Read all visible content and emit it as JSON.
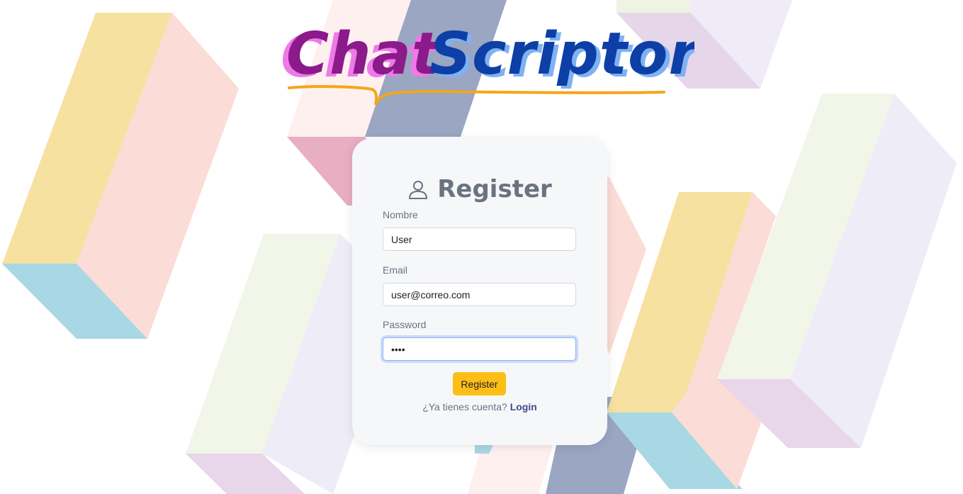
{
  "logo": {
    "part1": "Chat",
    "part2": "Scriptor"
  },
  "colors": {
    "logo_chat": "#8b1a8b",
    "logo_chat_shadow": "#ee7ae8",
    "logo_scriptor": "#0d3fa6",
    "logo_scriptor_shadow": "#7fb2f2",
    "underline": "#f4a619",
    "button": "#fbbf16",
    "link": "#3f4a8a"
  },
  "register_form": {
    "title": "Register",
    "title_icon": "user-icon",
    "nombre": {
      "label": "Nombre",
      "value": "User"
    },
    "email": {
      "label": "Email",
      "value": "user@correo.com"
    },
    "password": {
      "label": "Password",
      "value": "••••"
    },
    "submit_label": "Register",
    "login_prompt": "¿Ya tienes cuenta?",
    "login_link": "Login"
  }
}
